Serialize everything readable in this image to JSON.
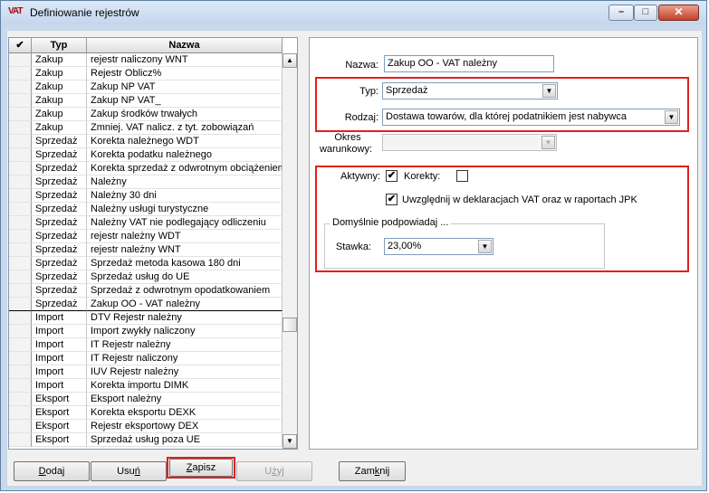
{
  "window": {
    "title": "Definiowanie rejestrów",
    "app_icon_text": "VAT"
  },
  "grid": {
    "headers": [
      "✔",
      "Typ",
      "Nazwa"
    ],
    "rows": [
      {
        "typ": "Zakup",
        "nazwa": "rejestr naliczony WNT"
      },
      {
        "typ": "Zakup",
        "nazwa": "Rejestr Oblicz%"
      },
      {
        "typ": "Zakup",
        "nazwa": "Zakup NP VAT"
      },
      {
        "typ": "Zakup",
        "nazwa": "Zakup NP VAT_"
      },
      {
        "typ": "Zakup",
        "nazwa": "Zakup środków trwałych"
      },
      {
        "typ": "Zakup",
        "nazwa": "Zmniej. VAT nalicz. z tyt. zobowiązań"
      },
      {
        "typ": "Sprzedaż",
        "nazwa": "Korekta należnego WDT"
      },
      {
        "typ": "Sprzedaż",
        "nazwa": "Korekta podatku należnego"
      },
      {
        "typ": "Sprzedaż",
        "nazwa": "Korekta sprzedaż z odwrotnym obciążeniem"
      },
      {
        "typ": "Sprzedaż",
        "nazwa": "Należny"
      },
      {
        "typ": "Sprzedaż",
        "nazwa": "Należny 30 dni"
      },
      {
        "typ": "Sprzedaż",
        "nazwa": "Należny usługi turystyczne"
      },
      {
        "typ": "Sprzedaż",
        "nazwa": "Należny VAT nie podlegający odliczeniu"
      },
      {
        "typ": "Sprzedaż",
        "nazwa": "rejestr należny WDT"
      },
      {
        "typ": "Sprzedaż",
        "nazwa": "rejestr należny WNT"
      },
      {
        "typ": "Sprzedaż",
        "nazwa": "Sprzedaż metoda kasowa 180 dni"
      },
      {
        "typ": "Sprzedaż",
        "nazwa": "Sprzedaż usług do UE"
      },
      {
        "typ": "Sprzedaż",
        "nazwa": "Sprzedaż z odwrotnym opodatkowaniem"
      },
      {
        "typ": "Sprzedaż",
        "nazwa": "Zakup OO - VAT należny",
        "selected": true
      },
      {
        "typ": "Import",
        "nazwa": "DTV Rejestr należny"
      },
      {
        "typ": "Import",
        "nazwa": "Import zwykły naliczony"
      },
      {
        "typ": "Import",
        "nazwa": "IT Rejestr należny"
      },
      {
        "typ": "Import",
        "nazwa": "IT Rejestr naliczony"
      },
      {
        "typ": "Import",
        "nazwa": "IUV Rejestr należny"
      },
      {
        "typ": "Import",
        "nazwa": "Korekta importu DIMK"
      },
      {
        "typ": "Eksport",
        "nazwa": "Eksport należny"
      },
      {
        "typ": "Eksport",
        "nazwa": "Korekta eksportu DEXK"
      },
      {
        "typ": "Eksport",
        "nazwa": "Rejestr eksportowy DEX"
      },
      {
        "typ": "Eksport",
        "nazwa": "Sprzedaż usług poza UE"
      }
    ]
  },
  "form": {
    "nazwa_label": "Nazwa:",
    "nazwa_value": "Zakup OO - VAT należny",
    "typ_label": "Typ:",
    "typ_value": "Sprzedaż",
    "rodzaj_label": "Rodzaj:",
    "rodzaj_value": "Dostawa towarów, dla której podatnikiem jest nabywca",
    "okres_label_1": "Okres",
    "okres_label_2": "warunkowy:",
    "okres_value": "",
    "aktywny_label": "Aktywny:",
    "aktywny_checked": true,
    "korekty_label": "Korekty:",
    "korekty_checked": false,
    "uwzglednij_label": "Uwzględnij w deklaracjach VAT oraz w raportach JPK",
    "uwzglednij_checked": true,
    "group_title": "Domyślnie podpowiadaj ...",
    "stawka_label": "Stawka:",
    "stawka_value": "23,00%"
  },
  "buttons": {
    "dodaj_first": "D",
    "dodaj_rest": "odaj",
    "usun_first": "Usu",
    "usun_u": "ń",
    "usun_rest": "",
    "zapisz_first": "",
    "zapisz_u": "Z",
    "zapisz_rest": "apisz",
    "uzyj_first": "U",
    "uzyj_u": "ż",
    "uzyj_rest": "yj",
    "zamknij_first": "Zam",
    "zamknij_u": "k",
    "zamknij_rest": "nij"
  },
  "colors": {
    "highlight_red": "#e02020",
    "title_bar": "#c9d8ea"
  }
}
